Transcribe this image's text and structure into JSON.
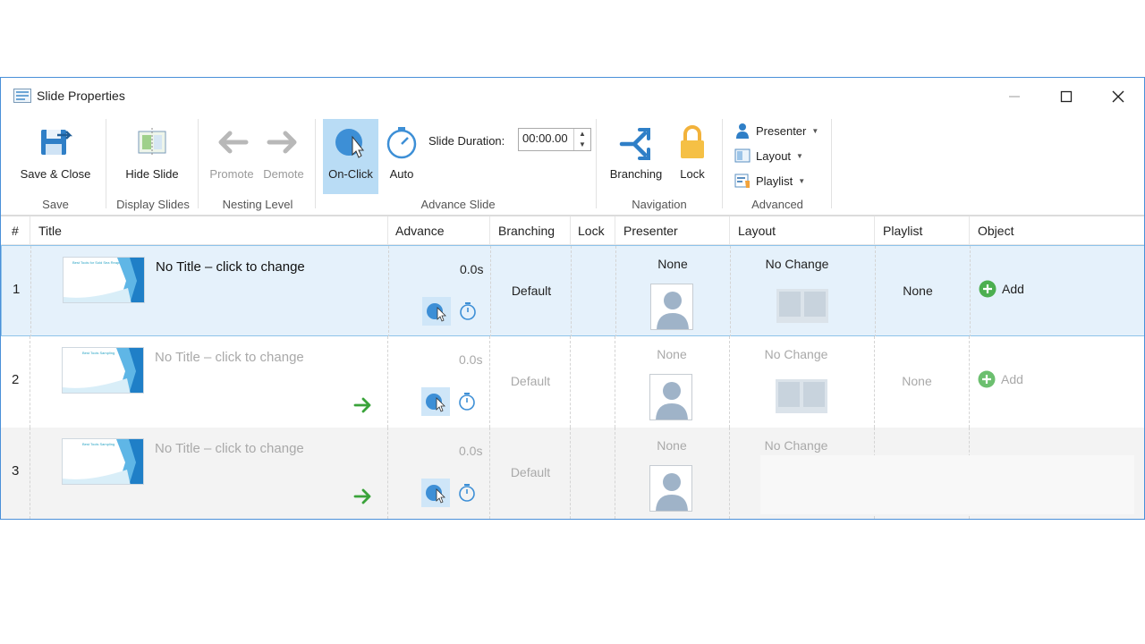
{
  "window": {
    "title": "Slide Properties"
  },
  "ribbon": {
    "save_group": {
      "label": "Save",
      "save_close": "Save & Close"
    },
    "display_group": {
      "label": "Display Slides",
      "hide_slide": "Hide Slide"
    },
    "nesting_group": {
      "label": "Nesting Level",
      "promote": "Promote",
      "demote": "Demote"
    },
    "advance_group": {
      "label": "Advance Slide",
      "on_click": "On-Click",
      "auto": "Auto",
      "duration_label": "Slide Duration:",
      "duration_value": "00:00.00"
    },
    "navigation_group": {
      "label": "Navigation",
      "branching": "Branching",
      "lock": "Lock"
    },
    "advanced_group": {
      "label": "Advanced",
      "presenter": "Presenter",
      "layout": "Layout",
      "playlist": "Playlist"
    }
  },
  "table": {
    "headers": {
      "num": "#",
      "title": "Title",
      "advance": "Advance",
      "branching": "Branching",
      "lock": "Lock",
      "presenter": "Presenter",
      "layout": "Layout",
      "playlist": "Playlist",
      "object": "Object"
    },
    "rows": [
      {
        "num": "1",
        "title": "No Title – click to change",
        "thumb_text": "Best Tools for Sold Sea Reaping",
        "advance": "0.0s",
        "branching": "Default",
        "presenter": "None",
        "layout": "No Change",
        "playlist": "None",
        "object": "Add"
      },
      {
        "num": "2",
        "title": "No Title – click to change",
        "thumb_text": "Best Tools Sampling",
        "advance": "0.0s",
        "branching": "Default",
        "presenter": "None",
        "layout": "No Change",
        "playlist": "None",
        "object": "Add"
      },
      {
        "num": "3",
        "title": "No Title – click to change",
        "thumb_text": "Best Tools Sampling",
        "advance": "0.0s",
        "branching": "Default",
        "presenter": "None",
        "layout": "No Change"
      }
    ]
  },
  "colors": {
    "accent": "#4a90d9",
    "selected_row": "#e5f1fb",
    "onclick_active": "#b9dcf5",
    "add_green": "#4caf50",
    "arrow_green": "#3aa33a"
  },
  "icons": [
    "app-icon",
    "save-close-icon",
    "hide-slide-icon",
    "promote-icon",
    "demote-icon",
    "on-click-icon",
    "auto-timer-icon",
    "branching-icon",
    "lock-icon",
    "presenter-icon",
    "layout-icon",
    "playlist-icon",
    "minimize-icon",
    "maximize-icon",
    "close-icon",
    "add-icon",
    "next-arrow-icon",
    "person-icon",
    "layout-thumb-icon"
  ]
}
